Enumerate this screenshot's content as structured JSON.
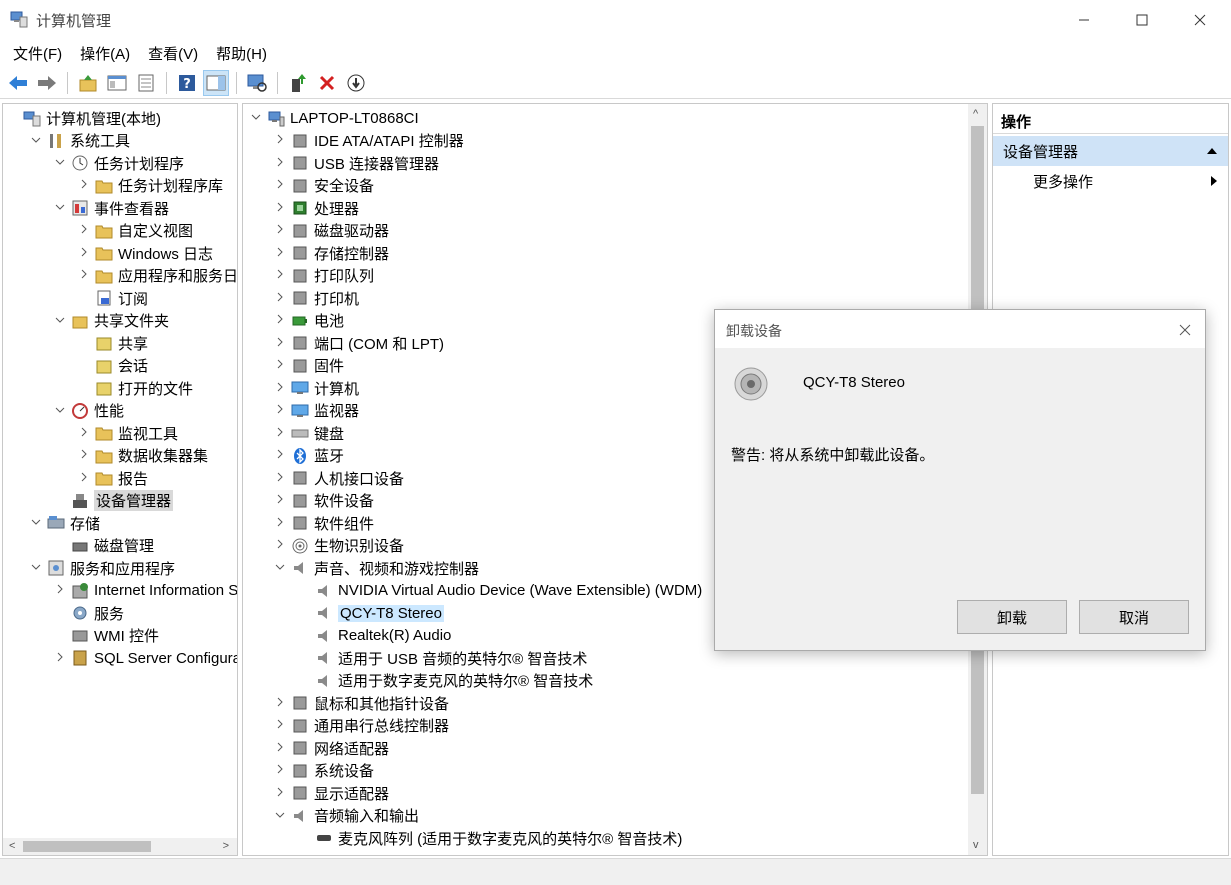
{
  "window": {
    "title": "计算机管理",
    "minimize_glyph": "—",
    "maximize_glyph": "☐",
    "close_glyph": "✕"
  },
  "menu": [
    "文件(F)",
    "操作(A)",
    "查看(V)",
    "帮助(H)"
  ],
  "toolbar": {
    "icons": [
      "back-arrow-icon",
      "forward-arrow-icon",
      "up-folder-icon",
      "show-hide-tree-icon",
      "export-list-icon",
      "help-icon",
      "action-pane-icon",
      "scan-hardware-icon",
      "update-driver-icon",
      "uninstall-icon",
      "disable-device-icon"
    ]
  },
  "left_tree": [
    {
      "label": "计算机管理(本地)",
      "level": 0,
      "arrow": "",
      "icon": "computer-management-icon"
    },
    {
      "label": "系统工具",
      "level": 1,
      "arrow": "v",
      "icon": "tools-icon"
    },
    {
      "label": "任务计划程序",
      "level": 2,
      "arrow": "v",
      "icon": "clock-icon"
    },
    {
      "label": "任务计划程序库",
      "level": 3,
      "arrow": ">",
      "icon": "folder-clock-icon"
    },
    {
      "label": "事件查看器",
      "level": 2,
      "arrow": "v",
      "icon": "event-viewer-icon"
    },
    {
      "label": "自定义视图",
      "level": 3,
      "arrow": ">",
      "icon": "folder-filter-icon"
    },
    {
      "label": "Windows 日志",
      "level": 3,
      "arrow": ">",
      "icon": "folder-log-icon"
    },
    {
      "label": "应用程序和服务日志",
      "level": 3,
      "arrow": ">",
      "icon": "folder-icon"
    },
    {
      "label": "订阅",
      "level": 3,
      "arrow": "",
      "icon": "subscription-icon"
    },
    {
      "label": "共享文件夹",
      "level": 2,
      "arrow": "v",
      "icon": "shared-folder-icon"
    },
    {
      "label": "共享",
      "level": 3,
      "arrow": "",
      "icon": "share-icon"
    },
    {
      "label": "会话",
      "level": 3,
      "arrow": "",
      "icon": "session-icon"
    },
    {
      "label": "打开的文件",
      "level": 3,
      "arrow": "",
      "icon": "open-files-icon"
    },
    {
      "label": "性能",
      "level": 2,
      "arrow": "v",
      "icon": "performance-icon"
    },
    {
      "label": "监视工具",
      "level": 3,
      "arrow": ">",
      "icon": "folder-monitor-icon"
    },
    {
      "label": "数据收集器集",
      "level": 3,
      "arrow": ">",
      "icon": "folder-collector-icon"
    },
    {
      "label": "报告",
      "level": 3,
      "arrow": ">",
      "icon": "folder-report-icon"
    },
    {
      "label": "设备管理器",
      "level": 2,
      "arrow": "",
      "icon": "device-manager-icon",
      "selected": true
    },
    {
      "label": "存储",
      "level": 1,
      "arrow": "v",
      "icon": "storage-icon"
    },
    {
      "label": "磁盘管理",
      "level": 2,
      "arrow": "",
      "icon": "disk-management-icon"
    },
    {
      "label": "服务和应用程序",
      "level": 1,
      "arrow": "v",
      "icon": "services-apps-icon"
    },
    {
      "label": "Internet Information Se",
      "level": 2,
      "arrow": ">",
      "icon": "iis-icon"
    },
    {
      "label": "服务",
      "level": 2,
      "arrow": "",
      "icon": "services-icon"
    },
    {
      "label": "WMI 控件",
      "level": 2,
      "arrow": "",
      "icon": "wmi-icon"
    },
    {
      "label": "SQL Server Configurati",
      "level": 2,
      "arrow": ">",
      "icon": "sql-server-icon"
    }
  ],
  "device_tree": [
    {
      "label": "LAPTOP-LT0868CI",
      "level": 0,
      "arrow": "v",
      "icon": "computer-icon"
    },
    {
      "label": "IDE ATA/ATAPI 控制器",
      "level": 1,
      "arrow": ">",
      "icon": "ide-controller-icon"
    },
    {
      "label": "USB 连接器管理器",
      "level": 1,
      "arrow": ">",
      "icon": "usb-icon"
    },
    {
      "label": "安全设备",
      "level": 1,
      "arrow": ">",
      "icon": "security-device-icon"
    },
    {
      "label": "处理器",
      "level": 1,
      "arrow": ">",
      "icon": "processor-icon"
    },
    {
      "label": "磁盘驱动器",
      "level": 1,
      "arrow": ">",
      "icon": "disk-drive-icon"
    },
    {
      "label": "存储控制器",
      "level": 1,
      "arrow": ">",
      "icon": "storage-controller-icon"
    },
    {
      "label": "打印队列",
      "level": 1,
      "arrow": ">",
      "icon": "print-queue-icon"
    },
    {
      "label": "打印机",
      "level": 1,
      "arrow": ">",
      "icon": "printer-icon"
    },
    {
      "label": "电池",
      "level": 1,
      "arrow": ">",
      "icon": "battery-icon"
    },
    {
      "label": "端口 (COM 和 LPT)",
      "level": 1,
      "arrow": ">",
      "icon": "port-icon"
    },
    {
      "label": "固件",
      "level": 1,
      "arrow": ">",
      "icon": "firmware-icon"
    },
    {
      "label": "计算机",
      "level": 1,
      "arrow": ">",
      "icon": "monitor-icon"
    },
    {
      "label": "监视器",
      "level": 1,
      "arrow": ">",
      "icon": "monitor-icon"
    },
    {
      "label": "键盘",
      "level": 1,
      "arrow": ">",
      "icon": "keyboard-icon"
    },
    {
      "label": "蓝牙",
      "level": 1,
      "arrow": ">",
      "icon": "bluetooth-icon"
    },
    {
      "label": "人机接口设备",
      "level": 1,
      "arrow": ">",
      "icon": "hid-icon"
    },
    {
      "label": "软件设备",
      "level": 1,
      "arrow": ">",
      "icon": "software-device-icon"
    },
    {
      "label": "软件组件",
      "level": 1,
      "arrow": ">",
      "icon": "software-component-icon"
    },
    {
      "label": "生物识别设备",
      "level": 1,
      "arrow": ">",
      "icon": "fingerprint-icon"
    },
    {
      "label": "声音、视频和游戏控制器",
      "level": 1,
      "arrow": "v",
      "icon": "speaker-icon"
    },
    {
      "label": "NVIDIA Virtual Audio Device (Wave Extensible) (WDM)",
      "level": 2,
      "arrow": "",
      "icon": "speaker-icon"
    },
    {
      "label": "QCY-T8 Stereo",
      "level": 2,
      "arrow": "",
      "icon": "speaker-icon",
      "selected": true
    },
    {
      "label": "Realtek(R) Audio",
      "level": 2,
      "arrow": "",
      "icon": "speaker-icon"
    },
    {
      "label": "适用于 USB 音频的英特尔® 智音技术",
      "level": 2,
      "arrow": "",
      "icon": "speaker-icon"
    },
    {
      "label": "适用于数字麦克风的英特尔® 智音技术",
      "level": 2,
      "arrow": "",
      "icon": "speaker-icon"
    },
    {
      "label": "鼠标和其他指针设备",
      "level": 1,
      "arrow": ">",
      "icon": "mouse-icon"
    },
    {
      "label": "通用串行总线控制器",
      "level": 1,
      "arrow": ">",
      "icon": "usb-controller-icon"
    },
    {
      "label": "网络适配器",
      "level": 1,
      "arrow": ">",
      "icon": "network-adapter-icon"
    },
    {
      "label": "系统设备",
      "level": 1,
      "arrow": ">",
      "icon": "system-device-icon"
    },
    {
      "label": "显示适配器",
      "level": 1,
      "arrow": ">",
      "icon": "display-adapter-icon"
    },
    {
      "label": "音频输入和输出",
      "level": 1,
      "arrow": "v",
      "icon": "speaker-icon"
    },
    {
      "label": "麦克风阵列 (适用于数字麦克风的英特尔® 智音技术)",
      "level": 2,
      "arrow": "",
      "icon": "microphone-icon"
    }
  ],
  "actions": {
    "header": "操作",
    "section": "设备管理器",
    "more": "更多操作"
  },
  "dialog": {
    "title": "卸载设备",
    "device_name": "QCY-T8 Stereo",
    "warning": "警告: 将从系统中卸载此设备。",
    "uninstall_label": "卸载",
    "cancel_label": "取消"
  }
}
